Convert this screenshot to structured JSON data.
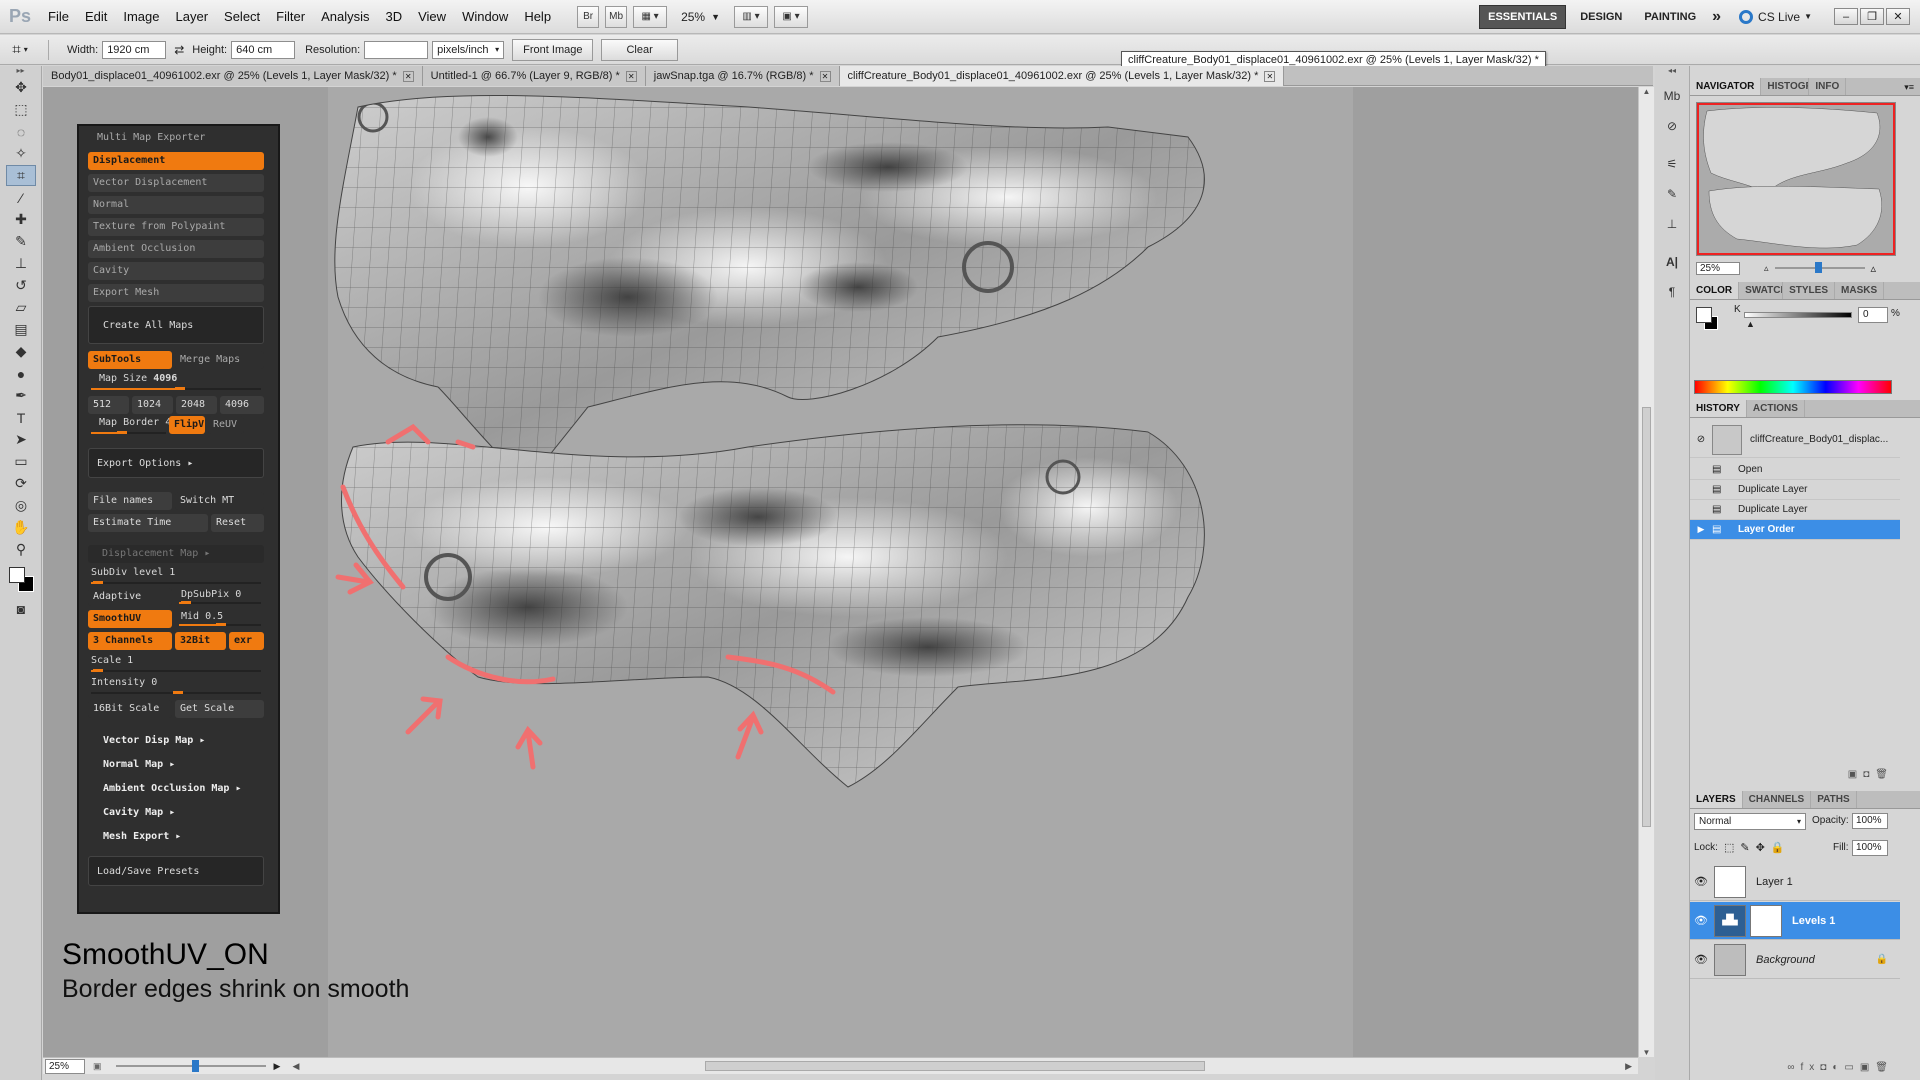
{
  "menubar": {
    "logo": "Ps",
    "items": [
      "File",
      "Edit",
      "Image",
      "Layer",
      "Select",
      "Filter",
      "Analysis",
      "3D",
      "View",
      "Window",
      "Help"
    ],
    "bridge_label": "Br",
    "minibridge_label": "Mb",
    "zoom": "25%",
    "workspaces": [
      "ESSENTIALS",
      "DESIGN",
      "PAINTING"
    ],
    "more": "»",
    "cslive": "CS Live"
  },
  "options": {
    "width_label": "Width:",
    "width_value": "1920 cm",
    "height_label": "Height:",
    "height_value": "640 cm",
    "resolution_label": "Resolution:",
    "resolution_value": "",
    "units": "pixels/inch",
    "front_image": "Front Image",
    "clear": "Clear"
  },
  "tooltip": "cliffCreature_Body01_displace01_40961002.exr @ 25% (Levels 1, Layer Mask/32) *",
  "tabs": [
    {
      "label": "Body01_displace01_40961002.exr @ 25% (Levels 1, Layer Mask/32) *"
    },
    {
      "label": "Untitled-1 @ 66.7% (Layer 9, RGB/8) *"
    },
    {
      "label": "jawSnap.tga @ 16.7% (RGB/8) *"
    },
    {
      "label": "cliffCreature_Body01_displace01_40961002.exr @ 25% (Levels 1, Layer Mask/32) *"
    }
  ],
  "zbrush": {
    "title": "Multi Map Exporter",
    "maps": [
      "Displacement",
      "Vector Displacement",
      "Normal",
      "Texture from Polypaint",
      "Ambient Occlusion",
      "Cavity",
      "Export Mesh"
    ],
    "create_all": "Create All Maps",
    "subtools": "SubTools",
    "merge_maps": "Merge Maps",
    "map_size_label": "Map Size",
    "map_size_value": "4096",
    "sizes": [
      "512",
      "1024",
      "2048",
      "4096"
    ],
    "map_border_label": "Map Border",
    "map_border_value": "4",
    "flipv": "FlipV",
    "reuv": "ReUV",
    "export_options": "Export Options",
    "file_names": "File names",
    "switch_mt": "Switch MT",
    "estimate_time": "Estimate Time",
    "reset": "Reset",
    "disp_map": "Displacement Map",
    "subdiv_label": "SubDiv level",
    "subdiv_value": "1",
    "adaptive": "Adaptive",
    "dpsubpix_label": "DpSubPix",
    "dpsubpix_value": "0",
    "smoothuv": "SmoothUV",
    "mid_label": "Mid",
    "mid_value": "0.5",
    "channels": "3 Channels",
    "bits": "32Bit",
    "exr": "exr",
    "scale_label": "Scale",
    "scale_value": "1",
    "intensity_label": "Intensity",
    "intensity_value": "0",
    "bit16_scale": "16Bit Scale",
    "get_scale": "Get Scale",
    "submenus": [
      "Vector Disp Map",
      "Normal Map",
      "Ambient Occlusion Map",
      "Cavity Map",
      "Mesh Export"
    ],
    "load_save": "Load/Save Presets"
  },
  "caption": {
    "line1": "SmoothUV_ON",
    "line2": "Border edges shrink on smooth"
  },
  "statusbar": {
    "zoom": "25%"
  },
  "panels": {
    "navigator_tabs": [
      "NAVIGATOR",
      "HISTOGRAM",
      "INFO"
    ],
    "nav_zoom": "25%",
    "color_tabs": [
      "COLOR",
      "SWATCHES",
      "STYLES",
      "MASKS"
    ],
    "color_k_label": "K",
    "color_k_value": "0",
    "color_pct": "%",
    "history_tabs": [
      "HISTORY",
      "ACTIONS"
    ],
    "history_snapshot": "cliffCreature_Body01_displac...",
    "history": [
      "Open",
      "Duplicate Layer",
      "Duplicate Layer",
      "Layer Order"
    ],
    "layers_tabs": [
      "LAYERS",
      "CHANNELS",
      "PATHS"
    ],
    "blend_mode": "Normal",
    "opacity_label": "Opacity:",
    "opacity_value": "100%",
    "lock_label": "Lock:",
    "fill_label": "Fill:",
    "fill_value": "100%",
    "layers": [
      "Layer 1",
      "Levels 1",
      "Background"
    ]
  },
  "colors": {
    "accent_orange": "#f07a10",
    "selection_blue": "#3c8ee6",
    "annotation_red": "#f07070"
  }
}
